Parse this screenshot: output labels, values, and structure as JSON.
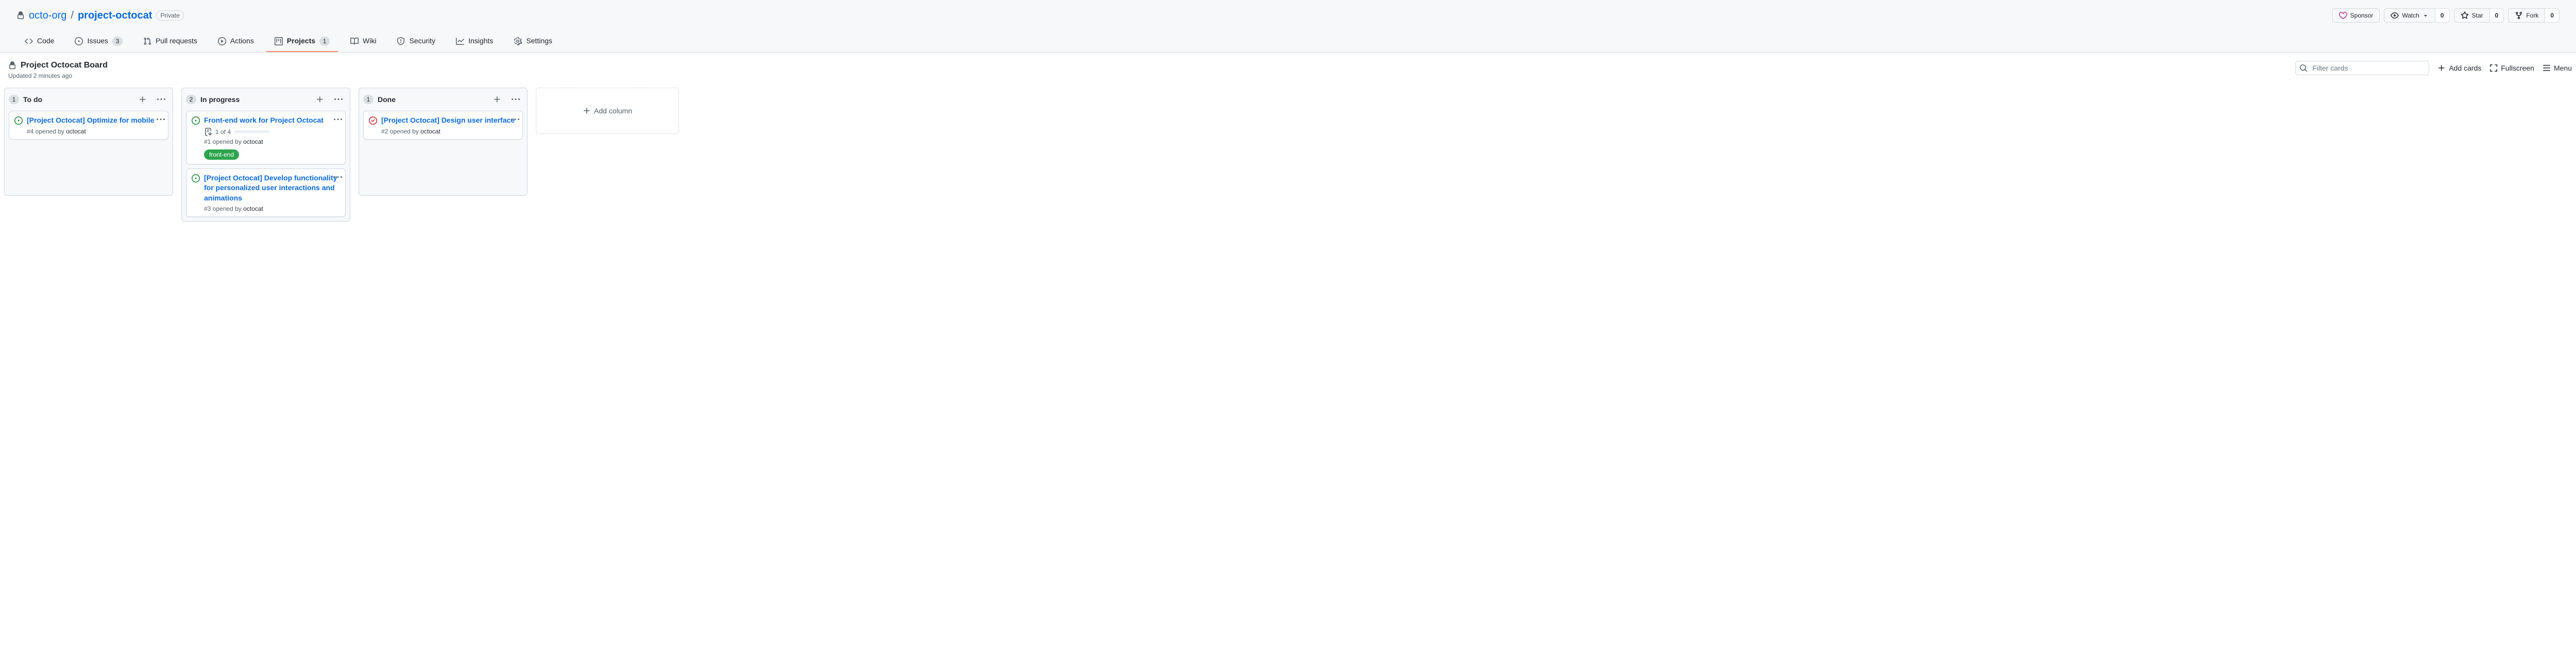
{
  "repo": {
    "org": "octo-org",
    "name": "project-octocat",
    "visibility": "Private"
  },
  "repoActions": {
    "sponsor": "Sponsor",
    "watch": "Watch",
    "watchCount": "0",
    "star": "Star",
    "starCount": "0",
    "fork": "Fork",
    "forkCount": "0"
  },
  "tabs": {
    "code": "Code",
    "issues": "Issues",
    "issuesCount": "3",
    "pulls": "Pull requests",
    "actions": "Actions",
    "projects": "Projects",
    "projectsCount": "1",
    "wiki": "Wiki",
    "security": "Security",
    "insights": "Insights",
    "settings": "Settings"
  },
  "project": {
    "title": "Project Octocat Board",
    "updated": "Updated 2 minutes ago"
  },
  "projectActions": {
    "searchPlaceholder": "Filter cards",
    "addCards": "Add cards",
    "fullscreen": "Fullscreen",
    "menu": "Menu"
  },
  "addColumn": "Add column",
  "columns": [
    {
      "count": "1",
      "title": "To do",
      "cards": [
        {
          "status": "open",
          "title": "[Project Octocat] Optimize for mobile",
          "meta": "#4 opened by ",
          "author": "octocat"
        }
      ]
    },
    {
      "count": "2",
      "title": "In progress",
      "cards": [
        {
          "status": "open",
          "title": "Front-end work for Project Octocat",
          "tasklist": "1 of 4",
          "progressPct": 25,
          "meta": "#1 opened by ",
          "author": "octocat",
          "label": "front-end"
        },
        {
          "status": "open",
          "title": "[Project Octocat] Develop functionality for personalized user interactions and animations",
          "meta": "#3 opened by ",
          "author": "octocat"
        }
      ]
    },
    {
      "count": "1",
      "title": "Done",
      "cards": [
        {
          "status": "closed",
          "title": "[Project Octocat] Design user interface",
          "meta": "#2 opened by ",
          "author": "octocat"
        }
      ]
    }
  ]
}
